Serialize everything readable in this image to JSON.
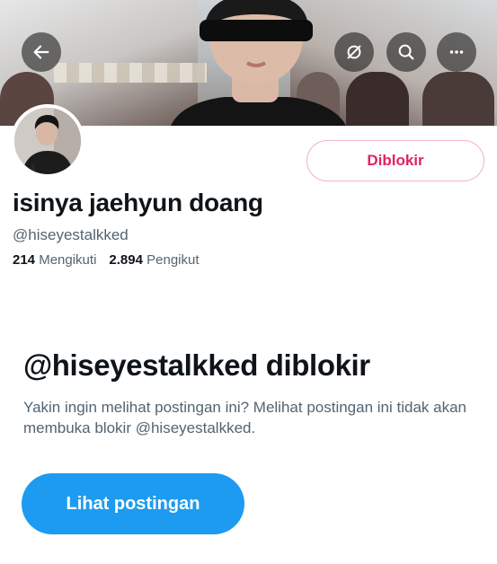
{
  "header": {
    "banner_image": "profile-header-photo",
    "back_icon": "arrow-left-icon",
    "icons": [
      "eye-off-icon",
      "search-icon",
      "more-icon"
    ]
  },
  "profile": {
    "avatar_image": "profile-avatar-photo",
    "display_name": "isinya jaehyun doang",
    "handle": "@hiseyestalkked",
    "following_count": "214",
    "following_label": "Mengikuti",
    "followers_count": "2.894",
    "followers_label": "Pengikut",
    "block_button_label": "Diblokir"
  },
  "blocked_notice": {
    "title": "@hiseyestalkked diblokir",
    "description": "Yakin ingin melihat postingan ini? Melihat postingan ini tidak akan membuka blokir @hiseyestalkked.",
    "button_label": "Lihat postingan"
  },
  "colors": {
    "accent": "#1d9bf0",
    "block_red": "#e0245e",
    "text_primary": "#0f1419",
    "text_secondary": "#536471"
  }
}
